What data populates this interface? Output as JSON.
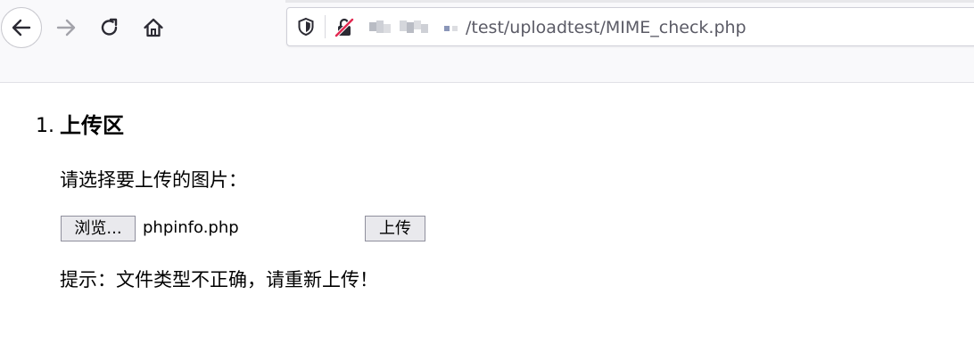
{
  "browser": {
    "url_visible_path": "/test/uploadtest/MIME_check.php",
    "icons": {
      "back": "back-arrow-icon",
      "forward": "forward-arrow-icon",
      "reload": "reload-icon",
      "home": "home-icon",
      "tracking": "shield-icon",
      "connection": "insecure-connection-icon"
    }
  },
  "page": {
    "list_marker": "1.",
    "heading": "上传区",
    "prompt": "请选择要上传的图片：",
    "file_button_label": "浏览...",
    "file_name": "phpinfo.php",
    "submit_label": "上传",
    "hint": "提示：文件类型不正确，请重新上传！"
  },
  "colors": {
    "toolbar_bg": "#f9f9fb",
    "insecure_red": "#e22850",
    "button_bg": "#e9e9ed"
  }
}
